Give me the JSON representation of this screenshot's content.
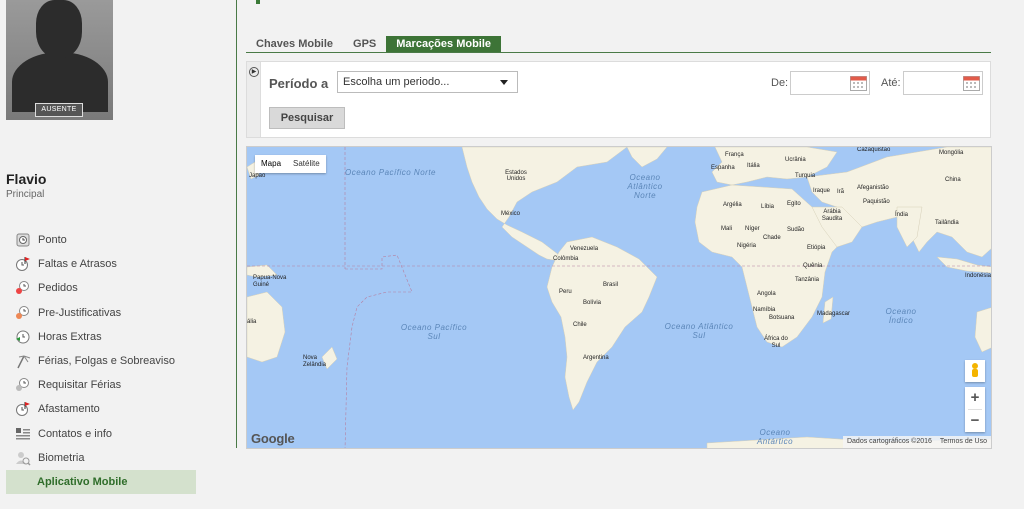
{
  "user": {
    "status": "AUSENTE",
    "name": "Flavio",
    "role": "Principal"
  },
  "menu": [
    {
      "label": "Ponto",
      "icon": "clock-icon"
    },
    {
      "label": "Faltas e Atrasos",
      "icon": "clock-flag-icon"
    },
    {
      "label": "Pedidos",
      "icon": "request-icon"
    },
    {
      "label": "Pre-Justificativas",
      "icon": "pre-justify-icon"
    },
    {
      "label": "Horas Extras",
      "icon": "overtime-icon"
    },
    {
      "label": "Férias, Folgas e Sobreaviso",
      "icon": "vacation-icon"
    },
    {
      "label": "Requisitar Férias",
      "icon": "request-vacation-icon"
    },
    {
      "label": "Afastamento",
      "icon": "leave-icon"
    },
    {
      "label": "Contatos e info",
      "icon": "contacts-icon"
    },
    {
      "label": "Biometria",
      "icon": "biometrics-icon"
    },
    {
      "label": "Aplicativo Mobile",
      "icon": ""
    }
  ],
  "tabs": [
    "Chaves Mobile",
    "GPS",
    "Marcações Mobile"
  ],
  "filter": {
    "periodo_label": "Período a",
    "periodo_placeholder": "Escolha um periodo...",
    "from_label": "De:",
    "to_label": "Até:",
    "search_button": "Pesquisar"
  },
  "map": {
    "type_map": "Mapa",
    "type_satellite": "Satélite",
    "zoom_in": "+",
    "zoom_out": "−",
    "logo": "Google",
    "attribution": "Dados cartográficos ©2016",
    "terms": "Termos de Uso",
    "oceans": [
      "Oceano Pacífico Norte",
      "Oceano Atlântico Norte",
      "Oceano Pacífico Sul",
      "Oceano Atlântico Sul",
      "Oceano Índico",
      "Oceano Antártico"
    ],
    "places": [
      "Japão",
      "Estados Unidos",
      "México",
      "Venezuela",
      "Colômbia",
      "Peru",
      "Brasil",
      "Bolívia",
      "Chile",
      "Argentina",
      "França",
      "Espanha",
      "Itália",
      "Ucrânia",
      "Turquia",
      "Iraque",
      "Irã",
      "Afeganistão",
      "Paquistão",
      "Índia",
      "Mongólia",
      "China",
      "Cazaquistão",
      "Argélia",
      "Líbia",
      "Egito",
      "Arábia Saudita",
      "Mali",
      "Níger",
      "Chade",
      "Sudão",
      "Nigéria",
      "Etiópia",
      "Quênia",
      "Tanzânia",
      "Angola",
      "Namíbia",
      "Botsuana",
      "Madagascar",
      "África do Sul",
      "Tailândia",
      "Indonésia",
      "Papua-Nova Guiné",
      "Nova Zelândia",
      "ália"
    ]
  }
}
